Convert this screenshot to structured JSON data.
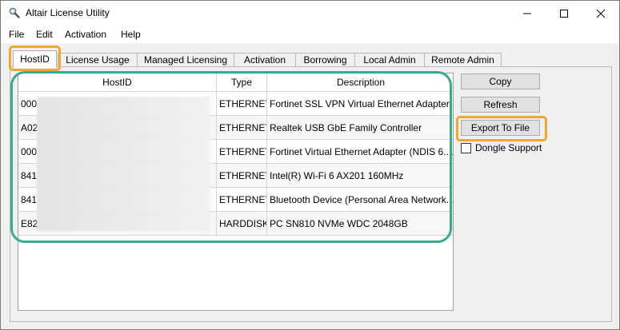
{
  "window": {
    "title": "Altair License Utility",
    "icon": "magnifier-icon"
  },
  "menu": [
    "File",
    "Edit",
    "Activation",
    "Help"
  ],
  "tabs": [
    "HostID",
    "License Usage",
    "Managed Licensing",
    "Activation",
    "Borrowing",
    "Local Admin",
    "Remote Admin"
  ],
  "active_tab": "HostID",
  "table": {
    "columns": [
      "HostID",
      "Type",
      "Description"
    ],
    "rows": [
      {
        "hostid": "000",
        "type": "ETHERNET",
        "description": "Fortinet SSL VPN Virtual Ethernet Adapter"
      },
      {
        "hostid": "A02",
        "type": "ETHERNET",
        "description": "Realtek USB GbE Family Controller"
      },
      {
        "hostid": "000",
        "type": "ETHERNET",
        "description": "Fortinet Virtual Ethernet Adapter (NDIS 6...."
      },
      {
        "hostid": "841",
        "type": "ETHERNET",
        "description": "Intel(R) Wi-Fi 6 AX201 160MHz"
      },
      {
        "hostid": "841",
        "type": "ETHERNET",
        "description": "Bluetooth Device (Personal Area Network..."
      },
      {
        "hostid": "E82",
        "type": "HARDDISK",
        "description": "PC SN810 NVMe WDC 2048GB"
      }
    ]
  },
  "buttons": {
    "copy": "Copy",
    "refresh": "Refresh",
    "export": "Export To File"
  },
  "dongle_support": {
    "label": "Dongle Support",
    "checked": false
  },
  "colors": {
    "highlight_orange": "#f0a830",
    "highlight_teal": "#3aaa8e"
  }
}
